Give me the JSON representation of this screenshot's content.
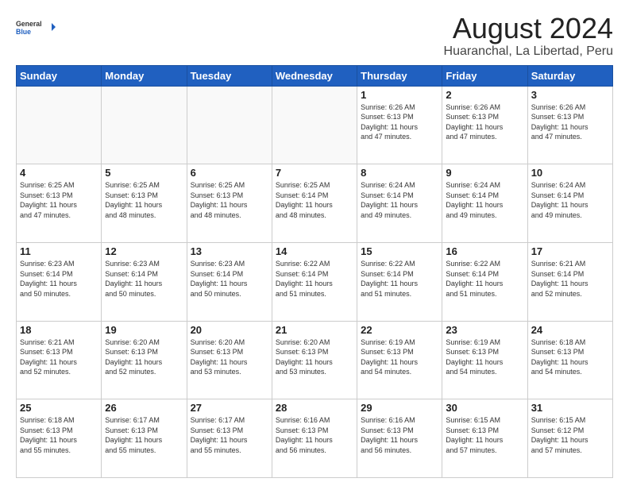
{
  "header": {
    "logo_general": "General",
    "logo_blue": "Blue",
    "month_title": "August 2024",
    "location": "Huaranchal, La Libertad, Peru"
  },
  "weekdays": [
    "Sunday",
    "Monday",
    "Tuesday",
    "Wednesday",
    "Thursday",
    "Friday",
    "Saturday"
  ],
  "weeks": [
    [
      {
        "day": "",
        "info": ""
      },
      {
        "day": "",
        "info": ""
      },
      {
        "day": "",
        "info": ""
      },
      {
        "day": "",
        "info": ""
      },
      {
        "day": "1",
        "info": "Sunrise: 6:26 AM\nSunset: 6:13 PM\nDaylight: 11 hours\nand 47 minutes."
      },
      {
        "day": "2",
        "info": "Sunrise: 6:26 AM\nSunset: 6:13 PM\nDaylight: 11 hours\nand 47 minutes."
      },
      {
        "day": "3",
        "info": "Sunrise: 6:26 AM\nSunset: 6:13 PM\nDaylight: 11 hours\nand 47 minutes."
      }
    ],
    [
      {
        "day": "4",
        "info": "Sunrise: 6:25 AM\nSunset: 6:13 PM\nDaylight: 11 hours\nand 47 minutes."
      },
      {
        "day": "5",
        "info": "Sunrise: 6:25 AM\nSunset: 6:13 PM\nDaylight: 11 hours\nand 48 minutes."
      },
      {
        "day": "6",
        "info": "Sunrise: 6:25 AM\nSunset: 6:13 PM\nDaylight: 11 hours\nand 48 minutes."
      },
      {
        "day": "7",
        "info": "Sunrise: 6:25 AM\nSunset: 6:14 PM\nDaylight: 11 hours\nand 48 minutes."
      },
      {
        "day": "8",
        "info": "Sunrise: 6:24 AM\nSunset: 6:14 PM\nDaylight: 11 hours\nand 49 minutes."
      },
      {
        "day": "9",
        "info": "Sunrise: 6:24 AM\nSunset: 6:14 PM\nDaylight: 11 hours\nand 49 minutes."
      },
      {
        "day": "10",
        "info": "Sunrise: 6:24 AM\nSunset: 6:14 PM\nDaylight: 11 hours\nand 49 minutes."
      }
    ],
    [
      {
        "day": "11",
        "info": "Sunrise: 6:23 AM\nSunset: 6:14 PM\nDaylight: 11 hours\nand 50 minutes."
      },
      {
        "day": "12",
        "info": "Sunrise: 6:23 AM\nSunset: 6:14 PM\nDaylight: 11 hours\nand 50 minutes."
      },
      {
        "day": "13",
        "info": "Sunrise: 6:23 AM\nSunset: 6:14 PM\nDaylight: 11 hours\nand 50 minutes."
      },
      {
        "day": "14",
        "info": "Sunrise: 6:22 AM\nSunset: 6:14 PM\nDaylight: 11 hours\nand 51 minutes."
      },
      {
        "day": "15",
        "info": "Sunrise: 6:22 AM\nSunset: 6:14 PM\nDaylight: 11 hours\nand 51 minutes."
      },
      {
        "day": "16",
        "info": "Sunrise: 6:22 AM\nSunset: 6:14 PM\nDaylight: 11 hours\nand 51 minutes."
      },
      {
        "day": "17",
        "info": "Sunrise: 6:21 AM\nSunset: 6:14 PM\nDaylight: 11 hours\nand 52 minutes."
      }
    ],
    [
      {
        "day": "18",
        "info": "Sunrise: 6:21 AM\nSunset: 6:13 PM\nDaylight: 11 hours\nand 52 minutes."
      },
      {
        "day": "19",
        "info": "Sunrise: 6:20 AM\nSunset: 6:13 PM\nDaylight: 11 hours\nand 52 minutes."
      },
      {
        "day": "20",
        "info": "Sunrise: 6:20 AM\nSunset: 6:13 PM\nDaylight: 11 hours\nand 53 minutes."
      },
      {
        "day": "21",
        "info": "Sunrise: 6:20 AM\nSunset: 6:13 PM\nDaylight: 11 hours\nand 53 minutes."
      },
      {
        "day": "22",
        "info": "Sunrise: 6:19 AM\nSunset: 6:13 PM\nDaylight: 11 hours\nand 54 minutes."
      },
      {
        "day": "23",
        "info": "Sunrise: 6:19 AM\nSunset: 6:13 PM\nDaylight: 11 hours\nand 54 minutes."
      },
      {
        "day": "24",
        "info": "Sunrise: 6:18 AM\nSunset: 6:13 PM\nDaylight: 11 hours\nand 54 minutes."
      }
    ],
    [
      {
        "day": "25",
        "info": "Sunrise: 6:18 AM\nSunset: 6:13 PM\nDaylight: 11 hours\nand 55 minutes."
      },
      {
        "day": "26",
        "info": "Sunrise: 6:17 AM\nSunset: 6:13 PM\nDaylight: 11 hours\nand 55 minutes."
      },
      {
        "day": "27",
        "info": "Sunrise: 6:17 AM\nSunset: 6:13 PM\nDaylight: 11 hours\nand 55 minutes."
      },
      {
        "day": "28",
        "info": "Sunrise: 6:16 AM\nSunset: 6:13 PM\nDaylight: 11 hours\nand 56 minutes."
      },
      {
        "day": "29",
        "info": "Sunrise: 6:16 AM\nSunset: 6:13 PM\nDaylight: 11 hours\nand 56 minutes."
      },
      {
        "day": "30",
        "info": "Sunrise: 6:15 AM\nSunset: 6:13 PM\nDaylight: 11 hours\nand 57 minutes."
      },
      {
        "day": "31",
        "info": "Sunrise: 6:15 AM\nSunset: 6:12 PM\nDaylight: 11 hours\nand 57 minutes."
      }
    ]
  ]
}
